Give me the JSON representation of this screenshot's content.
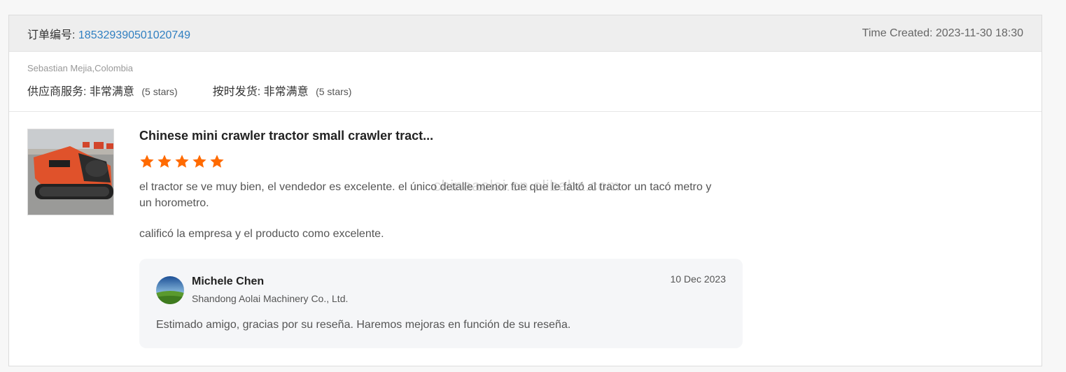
{
  "header": {
    "order_label": "订单编号:",
    "order_number": "185329390501020749",
    "time_created": "Time Created: 2023-11-30 18:30"
  },
  "buyer": {
    "name": "Sebastian Mejia,Colombia",
    "ratings": [
      {
        "label": "供应商服务:",
        "value": "非常满意",
        "note": "(5 stars)"
      },
      {
        "label": "按时发货:",
        "value": "非常满意",
        "note": "(5 stars)"
      }
    ]
  },
  "review": {
    "product_title": "Chinese mini crawler tractor small crawler tract...",
    "stars": 5,
    "star_color": "#ff6a00",
    "text_lines": [
      "el tractor se ve muy bien, el vendedor es excelente. el único detalle menor fue que le faltó al tractor un tacó metro y un horometro.",
      "calificó la empresa y el producto como excelente."
    ],
    "watermark": "chinaaolai.en.alibaba.com"
  },
  "reply": {
    "name": "Michele Chen",
    "company": "Shandong Aolai Machinery Co., Ltd.",
    "date": "10 Dec 2023",
    "text": "Estimado amigo, gracias por su reseña. Haremos mejoras en función de su reseña."
  }
}
